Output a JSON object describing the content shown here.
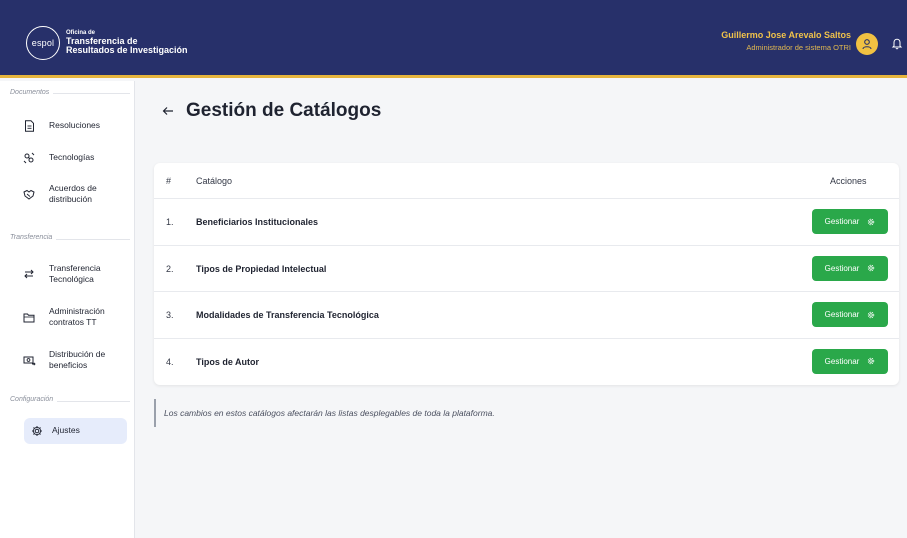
{
  "header": {
    "logo_badge": "espol",
    "logo_small": "Oficina de",
    "logo_line1": "Transferencia de",
    "logo_line2": "Resultados de Investigación",
    "user_name": "Guillermo Jose Arevalo Saltos",
    "user_role": "Administrador de sistema OTRI",
    "colors": {
      "background": "#27306a",
      "accent": "#e6b43c"
    }
  },
  "sidebar": {
    "sections": [
      {
        "label": "Documentos"
      },
      {
        "label": "Transferencia"
      },
      {
        "label": "Configuración"
      }
    ],
    "items": [
      {
        "label": "Resoluciones",
        "icon": "document-icon"
      },
      {
        "label": "Tecnologías",
        "icon": "tech-icon"
      },
      {
        "label": "Acuerdos de distribución",
        "icon": "handshake-icon"
      },
      {
        "label": "Transferencia Tecnológica",
        "icon": "transfer-icon"
      },
      {
        "label": "Administración contratos TT",
        "icon": "folder-icon"
      },
      {
        "label": "Distribución de beneficios",
        "icon": "benefits-icon"
      },
      {
        "label": "Ajustes",
        "icon": "gear-icon",
        "active": true
      }
    ]
  },
  "main": {
    "title": "Gestión de Catálogos",
    "table": {
      "headers": {
        "num": "#",
        "name": "Catálogo",
        "actions": "Acciones"
      },
      "rows": [
        {
          "num": "1.",
          "name": "Beneficiarios Institucionales",
          "action": "Gestionar"
        },
        {
          "num": "2.",
          "name": "Tipos de Propiedad Intelectual",
          "action": "Gestionar"
        },
        {
          "num": "3.",
          "name": "Modalidades de Transferencia Tecnológica",
          "action": "Gestionar"
        },
        {
          "num": "4.",
          "name": "Tipos de Autor",
          "action": "Gestionar"
        }
      ]
    },
    "note": "Los cambios en estos catálogos afectarán las listas desplegables de toda la plataforma.",
    "button_color": "#2aa84a"
  }
}
